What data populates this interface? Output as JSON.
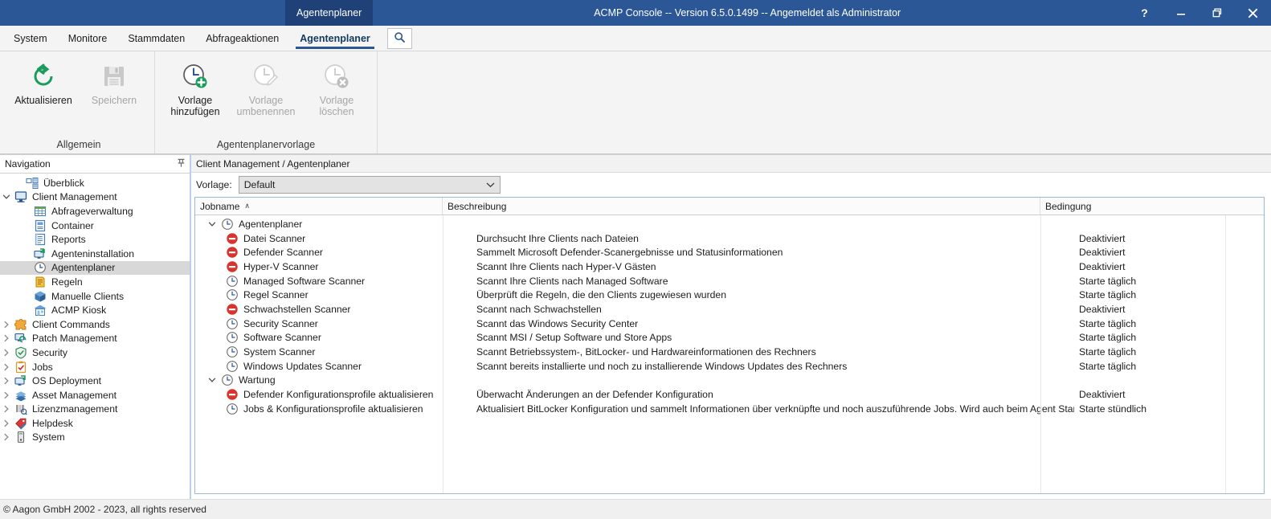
{
  "window": {
    "tab_label": "Agentenplaner",
    "title": "ACMP Console -- Version 6.5.0.1499 -- Angemeldet als Administrator",
    "buttons": {
      "help": "?",
      "minimize": "Minimieren",
      "restore": "Wiederherstellen",
      "close": "Schließen"
    },
    "accent_color": "#2b5797",
    "tab_color": "#1f4178"
  },
  "menu": {
    "items": [
      {
        "label": "System",
        "active": false
      },
      {
        "label": "Monitore",
        "active": false
      },
      {
        "label": "Stammdaten",
        "active": false
      },
      {
        "label": "Abfrageaktionen",
        "active": false
      },
      {
        "label": "Agentenplaner",
        "active": true
      }
    ],
    "search_icon": "search-icon"
  },
  "ribbon": {
    "groups": [
      {
        "title": "Allgemein",
        "buttons": [
          {
            "label": "Aktualisieren",
            "icon": "refresh-icon",
            "disabled": false
          },
          {
            "label": "Speichern",
            "icon": "save-icon",
            "disabled": true
          }
        ]
      },
      {
        "title": "Agentenplanervorlage",
        "buttons": [
          {
            "label": "Vorlage\nhinzufügen",
            "icon": "clock-add-icon",
            "disabled": false
          },
          {
            "label": "Vorlage\numbenennen",
            "icon": "clock-edit-icon",
            "disabled": true
          },
          {
            "label": "Vorlage\nlöschen",
            "icon": "clock-delete-icon",
            "disabled": true
          }
        ]
      }
    ]
  },
  "sidebar": {
    "header": "Navigation",
    "pin_icon": "pin-icon",
    "items": [
      {
        "label": "Überblick",
        "icon": "overview-icon",
        "level": 1,
        "expander": "",
        "selected": false
      },
      {
        "label": "Client Management",
        "icon": "monitor-icon",
        "level": 0,
        "expander": "expanded",
        "selected": false
      },
      {
        "label": "Abfrageverwaltung",
        "icon": "table-icon",
        "level": 2,
        "expander": "",
        "selected": false
      },
      {
        "label": "Container",
        "icon": "container-icon",
        "level": 2,
        "expander": "",
        "selected": false
      },
      {
        "label": "Reports",
        "icon": "report-icon",
        "level": 2,
        "expander": "",
        "selected": false
      },
      {
        "label": "Agenteninstallation",
        "icon": "agent-install-icon",
        "level": 2,
        "expander": "",
        "selected": false
      },
      {
        "label": "Agentenplaner",
        "icon": "clock-icon",
        "level": 2,
        "expander": "",
        "selected": true
      },
      {
        "label": "Regeln",
        "icon": "rules-icon",
        "level": 2,
        "expander": "",
        "selected": false
      },
      {
        "label": "Manuelle Clients",
        "icon": "box-icon",
        "level": 2,
        "expander": "",
        "selected": false
      },
      {
        "label": "ACMP Kiosk",
        "icon": "kiosk-icon",
        "level": 2,
        "expander": "",
        "selected": false
      },
      {
        "label": "Client Commands",
        "icon": "puzzle-icon",
        "level": 0,
        "expander": "collapsed",
        "selected": false
      },
      {
        "label": "Patch Management",
        "icon": "patch-icon",
        "level": 0,
        "expander": "collapsed",
        "selected": false
      },
      {
        "label": "Security",
        "icon": "shield-icon",
        "level": 0,
        "expander": "collapsed",
        "selected": false
      },
      {
        "label": "Jobs",
        "icon": "clipboard-icon",
        "level": 0,
        "expander": "collapsed",
        "selected": false
      },
      {
        "label": "OS Deployment",
        "icon": "deploy-icon",
        "level": 0,
        "expander": "collapsed",
        "selected": false
      },
      {
        "label": "Asset Management",
        "icon": "books-icon",
        "level": 0,
        "expander": "collapsed",
        "selected": false
      },
      {
        "label": "Lizenzmanagement",
        "icon": "license-icon",
        "level": 0,
        "expander": "collapsed",
        "selected": false
      },
      {
        "label": "Helpdesk",
        "icon": "tag-icon",
        "level": 0,
        "expander": "collapsed",
        "selected": false
      },
      {
        "label": "System",
        "icon": "server-icon",
        "level": 0,
        "expander": "collapsed",
        "selected": false
      }
    ]
  },
  "main": {
    "breadcrumb": "Client Management / Agentenplaner",
    "template_label": "Vorlage:",
    "template_value": "Default",
    "columns": [
      {
        "label": "Jobname",
        "sorted": "asc",
        "sort_glyph": "∧"
      },
      {
        "label": "Beschreibung",
        "sorted": "",
        "sort_glyph": ""
      },
      {
        "label": "Bedingung",
        "sorted": "",
        "sort_glyph": ""
      }
    ],
    "rows": [
      {
        "type": "group",
        "name": "Agentenplaner",
        "icon": "clock-icon",
        "expander": "expanded",
        "description": "",
        "condition": ""
      },
      {
        "type": "item",
        "name": "Datei Scanner",
        "icon": "disabled-icon",
        "description": "Durchsucht Ihre Clients nach Dateien",
        "condition": "Deaktiviert"
      },
      {
        "type": "item",
        "name": "Defender Scanner",
        "icon": "disabled-icon",
        "description": "Sammelt Microsoft Defender-Scanergebnisse und Statusinformationen",
        "condition": "Deaktiviert"
      },
      {
        "type": "item",
        "name": "Hyper-V Scanner",
        "icon": "disabled-icon",
        "description": "Scannt Ihre Clients nach Hyper-V Gästen",
        "condition": "Deaktiviert"
      },
      {
        "type": "item",
        "name": "Managed Software Scanner",
        "icon": "clock-icon",
        "description": "Scannt Ihre Clients nach Managed Software",
        "condition": "Starte täglich"
      },
      {
        "type": "item",
        "name": "Regel Scanner",
        "icon": "clock-icon",
        "description": "Überprüft die Regeln, die den Clients zugewiesen wurden",
        "condition": "Starte täglich"
      },
      {
        "type": "item",
        "name": "Schwachstellen Scanner",
        "icon": "disabled-icon",
        "description": "Scannt nach Schwachstellen",
        "condition": "Deaktiviert"
      },
      {
        "type": "item",
        "name": "Security Scanner",
        "icon": "clock-icon",
        "description": "Scannt das Windows Security Center",
        "condition": "Starte täglich"
      },
      {
        "type": "item",
        "name": "Software Scanner",
        "icon": "clock-icon",
        "description": "Scannt MSI / Setup Software und Store Apps",
        "condition": "Starte täglich"
      },
      {
        "type": "item",
        "name": "System Scanner",
        "icon": "clock-icon",
        "description": "Scannt Betriebssystem-, BitLocker- und Hardwareinformationen des Rechners",
        "condition": "Starte täglich"
      },
      {
        "type": "item",
        "name": "Windows Updates Scanner",
        "icon": "clock-icon",
        "description": "Scannt bereits installierte und noch zu installierende Windows Updates des Rechners",
        "condition": "Starte täglich"
      },
      {
        "type": "group",
        "name": "Wartung",
        "icon": "clock-icon",
        "expander": "expanded",
        "description": "",
        "condition": ""
      },
      {
        "type": "item",
        "name": "Defender Konfigurationsprofile aktualisieren",
        "icon": "disabled-icon",
        "description": "Überwacht Änderungen an der Defender Konfiguration",
        "condition": "Deaktiviert"
      },
      {
        "type": "item",
        "name": "Jobs & Konfigurationsprofile aktualisieren",
        "icon": "clock-icon",
        "description": "Aktualisiert BitLocker Konfiguration und sammelt Informationen über verknüpfte und noch auszuführende Jobs. Wird auch beim Agent Start ausgeführt.",
        "condition": "Starte stündlich"
      }
    ]
  },
  "footer": {
    "copyright": "© Aagon GmbH 2002 - 2023, all rights reserved"
  }
}
